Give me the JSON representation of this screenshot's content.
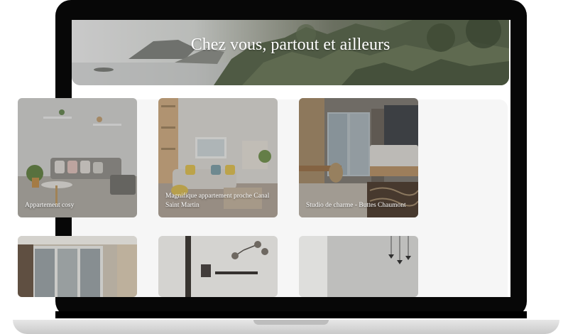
{
  "hero": {
    "title": "Chez vous, partout et ailleurs"
  },
  "listings": [
    {
      "label": "Appartement cosy"
    },
    {
      "label": "Magnifique appartement proche Canal Saint Martin"
    },
    {
      "label": "Studio de charme - Buttes Chaumont"
    },
    {
      "label": ""
    },
    {
      "label": ""
    },
    {
      "label": ""
    }
  ],
  "colors": {
    "device_frame": "#070707",
    "page_background": "#ffffff",
    "content_panel": "#f6f6f6",
    "text_on_image": "#ffffff"
  }
}
